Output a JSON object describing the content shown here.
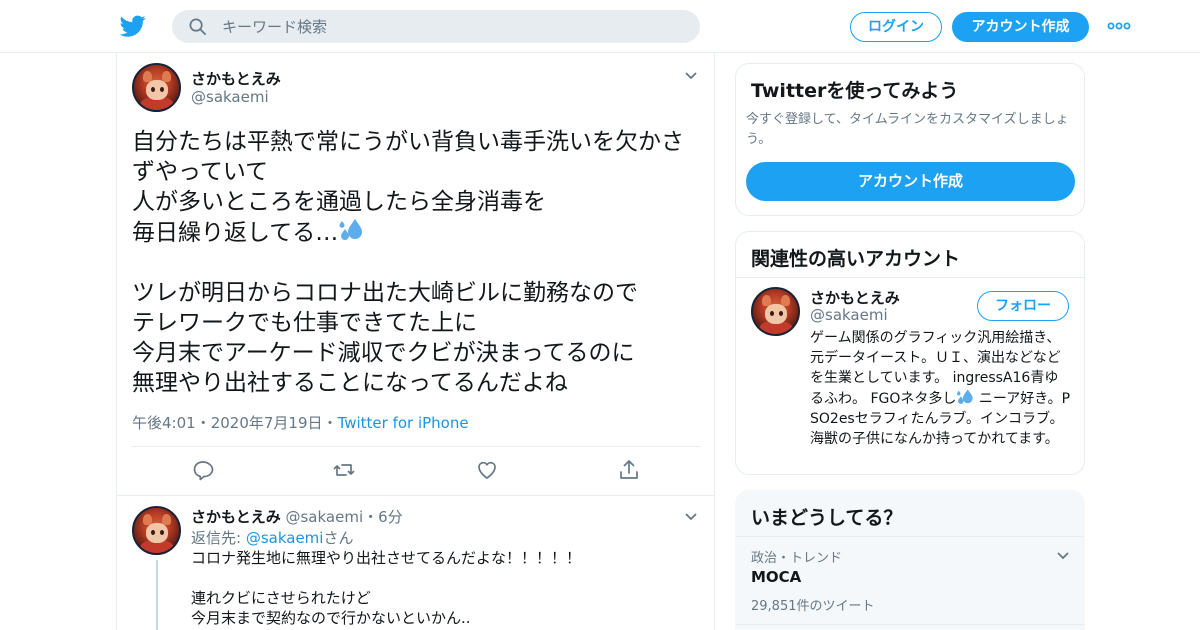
{
  "colors": {
    "brand": "#1da1f2",
    "link": "#1b95e0",
    "text_primary": "#14171a",
    "text_secondary": "#657786",
    "border": "#e6ecf0"
  },
  "header": {
    "logo_icon": "twitter-bird-icon",
    "search_placeholder": "キーワード検索",
    "login_label": "ログイン",
    "signup_label": "アカウント作成",
    "more_icon": "more-dots-icon"
  },
  "tweet": {
    "author_name": "さかもとえみ",
    "author_handle": "@sakaemi",
    "text_before_emoji": "自分たちは平熱で常にうがい背負い毒手洗いを欠かさ\nずやっていて\n人が多いところを通過したら全身消毒を\n毎日繰り返してる…",
    "emoji_icon": "sweat-droplets-icon",
    "text_after_emoji": "\n\nツレが明日からコロナ出た大崎ビルに勤務なので\nテレワークでも仕事できてた上に\n今月末でアーケード減収でクビが決まってるのに\n無理やり出社することになってるんだよね",
    "time": "午後4:01",
    "date": "2020年7月19日",
    "source": "Twitter for iPhone",
    "separator": "・",
    "actions": [
      "reply-icon",
      "retweet-icon",
      "like-icon",
      "share-icon"
    ]
  },
  "reply": {
    "author_name": "さかもとえみ",
    "author_handle": "@sakaemi",
    "separator": "・",
    "age": "6分",
    "reply_prefix": "返信先: ",
    "reply_to": "@sakaemi",
    "reply_suffix": "さん",
    "text": "コロナ発生地に無理やり出社させてるんだよな！！！！！\n\n連れクビにさせられたけど\n今月末まで契約なので行かないといかん.."
  },
  "signup_card": {
    "title": "Twitterを使ってみよう",
    "description": "今すぐ登録して、タイムラインをカスタマイズしましょう。",
    "button_label": "アカウント作成"
  },
  "related_card": {
    "title": "関連性の高いアカウント",
    "name": "さかもとえみ",
    "handle": "@sakaemi",
    "follow_label": "フォロー",
    "bio_before_emoji": "ゲーム関係のグラフィック汎用絵描き、元データイースト。ＵＩ、演出などなどを生業としています。 ingressA16青ゆるふわ。 FGOネタ多し",
    "bio_emoji_icon": "sweat-droplets-icon",
    "bio_after_emoji": " ニーア好き。PSO2esセラフィたんラブ。インコラブ。海獣の子供になんか持ってかれてます。"
  },
  "trends_card": {
    "title": "いまどうしてる？",
    "category": "政治・トレンド",
    "topic": "MOCA",
    "count": "29,851件のツイート"
  }
}
